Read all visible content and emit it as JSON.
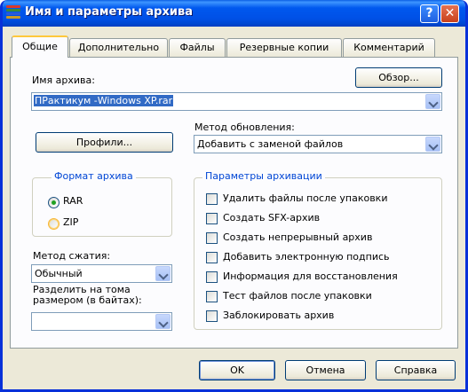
{
  "window": {
    "title": "Имя и параметры архива"
  },
  "titlebar": {
    "help": "?",
    "close": "✕"
  },
  "tabs": [
    {
      "label": "Общие",
      "active": true
    },
    {
      "label": "Дополнительно"
    },
    {
      "label": "Файлы"
    },
    {
      "label": "Резервные копии"
    },
    {
      "label": "Комментарий"
    }
  ],
  "archive_name": {
    "label": "Имя архива:",
    "browse": "Обзор...",
    "value": "ПРактикум -Windows XP.rar"
  },
  "profiles": {
    "label": "Профили..."
  },
  "update_method": {
    "label": "Метод обновления:",
    "value": "Добавить с заменой файлов"
  },
  "archive_format": {
    "legend": "Формат архива",
    "options": [
      {
        "label": "RAR",
        "checked": true
      },
      {
        "label": "ZIP",
        "checked": false
      }
    ]
  },
  "compression": {
    "label": "Метод сжатия:",
    "value": "Обычный"
  },
  "split": {
    "label_line1": "Разделить на тома",
    "label_line2": "размером (в байтах):",
    "value": ""
  },
  "archive_options": {
    "legend": "Параметры архивации",
    "items": [
      {
        "label": "Удалить файлы после упаковки",
        "checked": false
      },
      {
        "label": "Создать SFX-архив",
        "checked": false
      },
      {
        "label": "Создать непрерывный архив",
        "checked": false
      },
      {
        "label": "Добавить электронную подпись",
        "checked": false
      },
      {
        "label": "Информация для восстановления",
        "checked": false
      },
      {
        "label": "Тест файлов после упаковки",
        "checked": false
      },
      {
        "label": "Заблокировать архив",
        "checked": false
      }
    ]
  },
  "buttons": {
    "ok": "OK",
    "cancel": "Отмена",
    "help": "Справка"
  },
  "colors": {
    "titlebar": "#0058ee",
    "accent": "#316ac5",
    "legend": "#0046d5",
    "window_bg": "#ece9d8"
  },
  "icons": {
    "app": "winrar-books-icon",
    "dropdown": "chevron-down-icon"
  }
}
